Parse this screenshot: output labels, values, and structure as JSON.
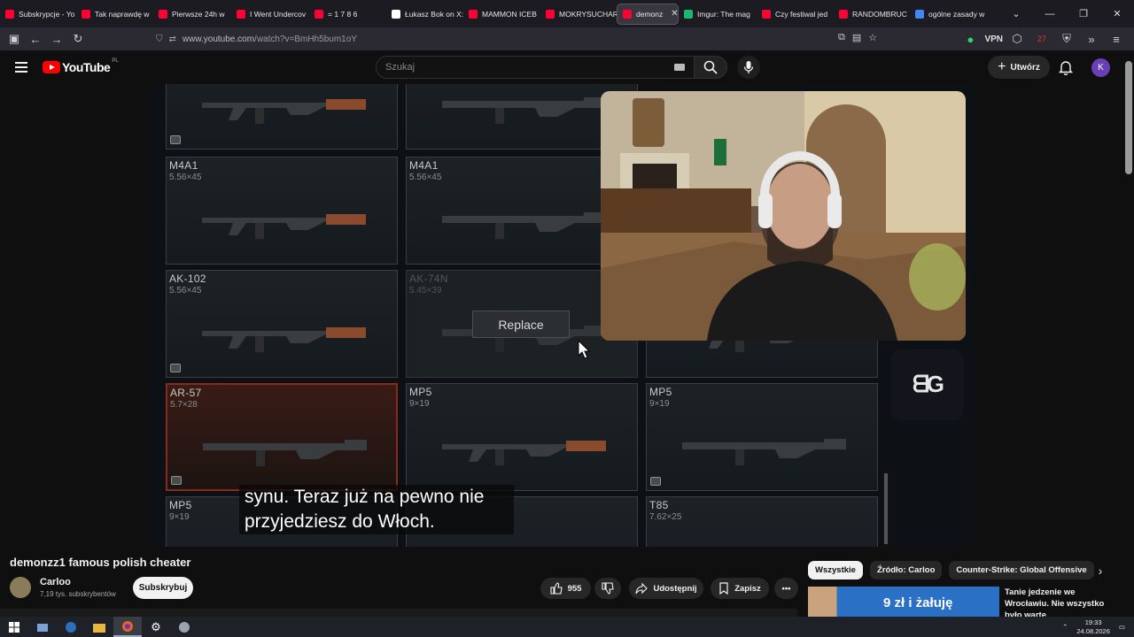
{
  "browser": {
    "tabs": [
      {
        "label": "Subskrypcje - Yo",
        "color": "#ff0033"
      },
      {
        "label": "Tak naprawdę w",
        "color": "#ff0033"
      },
      {
        "label": "Pierwsze 24h w",
        "color": "#ff0033"
      },
      {
        "label": "I Went Undercov",
        "color": "#ff0033"
      },
      {
        "label": "= 1 7 8 6 ",
        "color": "#ff0033"
      },
      {
        "label": "Łukasz Bok on X:",
        "color": "#ffffff"
      },
      {
        "label": "MAMMON ICEB",
        "color": "#ff0033"
      },
      {
        "label": "MOKRYSUCHAR",
        "color": "#ff0033"
      },
      {
        "label": "demonz",
        "color": "#ff0033",
        "active": true
      },
      {
        "label": "Imgur: The mag",
        "color": "#1bb76e"
      },
      {
        "label": "Czy festiwal jed",
        "color": "#ff0033"
      },
      {
        "label": "RANDOMBRUC",
        "color": "#ff0033"
      },
      {
        "label": "ogólne zasady w",
        "color": "#4285f4"
      }
    ],
    "url_prefix": "www.youtube.com",
    "url_path": "/watch?v=BmHh5bum1oY",
    "vpn_label": "VPN",
    "badge_count": "27"
  },
  "youtube": {
    "region": "PL",
    "logo_text": "YouTube",
    "search_placeholder": "Szukaj",
    "create_label": "Utwórz",
    "avatar_letter": "K"
  },
  "video": {
    "cards": [
      {
        "name": "",
        "caliber": "",
        "state": "normal",
        "box": true
      },
      {
        "name": "",
        "caliber": "",
        "state": "normal",
        "box": false
      },
      {
        "name": "M4A1",
        "caliber": "5.56×45",
        "state": "normal",
        "box": false
      },
      {
        "name": "M4A1",
        "caliber": "5.56×45",
        "state": "normal",
        "box": false
      },
      {
        "name": "AK-102",
        "caliber": "5.56×45",
        "state": "normal",
        "box": true
      },
      {
        "name": "AK-74N",
        "caliber": "5.45×39",
        "state": "dim",
        "box": false
      },
      {
        "name": "",
        "caliber": "",
        "state": "normal",
        "box": false
      },
      {
        "name": "AR-57",
        "caliber": "5.7×28",
        "state": "selected",
        "box": true
      },
      {
        "name": "MP5",
        "caliber": "9×19",
        "state": "normal",
        "box": false
      },
      {
        "name": "MP5",
        "caliber": "9×19",
        "state": "normal",
        "box": true
      },
      {
        "name": "MP5",
        "caliber": "9×19",
        "state": "normal",
        "box": false
      },
      {
        "name": "",
        "caliber": "",
        "state": "normal",
        "box": false
      },
      {
        "name": "T85",
        "caliber": "7.62×25",
        "state": "normal",
        "box": false
      }
    ],
    "replace_label": "Replace",
    "subtitle_line1": "synu. Teraz już na pewno nie",
    "subtitle_line2": "przyjedziesz do Włoch."
  },
  "info": {
    "title": "demonzz1 famous polish cheater",
    "channel": "Carloo",
    "subscribers": "7,19 tys. subskrybentów",
    "subscribe_label": "Subskrybuj",
    "likes": "955",
    "share_label": "Udostępnij",
    "save_label": "Zapisz"
  },
  "sidebar": {
    "chips": [
      "Wszystkie",
      "Źródło: Carloo",
      "Counter-Strike: Global Offensive"
    ],
    "rec_thumb_text": "9 zł i żałuję",
    "rec_title": "Tanie jedzenie we Wrocławiu. Nie wszystko było warte"
  },
  "taskbar": {
    "time": "19:33",
    "date": "24.08.2026"
  }
}
